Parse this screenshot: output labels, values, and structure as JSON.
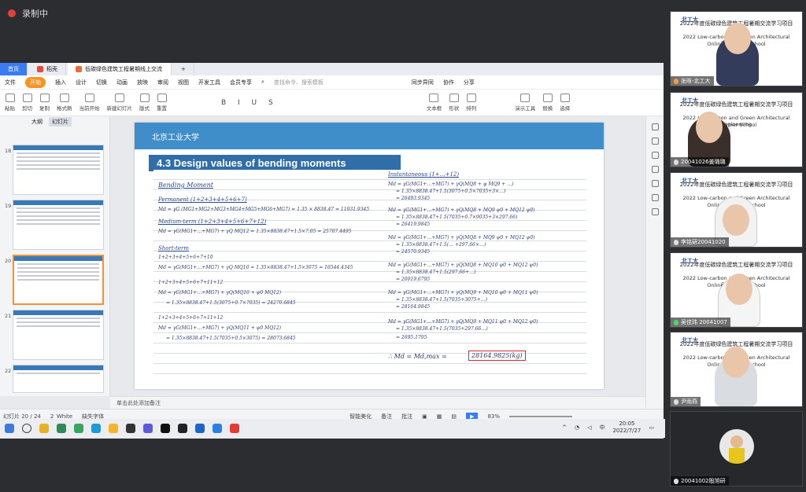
{
  "recording": {
    "label": "录制中"
  },
  "tabs": [
    {
      "label": "首页"
    },
    {
      "label": "稻壳"
    },
    {
      "label": "低碳绿色建筑工程暑期线上交流"
    }
  ],
  "menu": [
    "文件",
    "开始",
    "插入",
    "设计",
    "切换",
    "动画",
    "放映",
    "审阅",
    "视图",
    "开发工具",
    "会员专享"
  ],
  "search": {
    "placeholder": "查找命令、搜索模板"
  },
  "menu_right": [
    "同步异同",
    "协作",
    "分享"
  ],
  "ribbon": [
    "粘贴",
    "剪切",
    "复制",
    "格式刷",
    "当前开始",
    "新建幻灯片",
    "版式",
    "重置",
    "文本框",
    "形状",
    "排列",
    "演示工具",
    "替换",
    "选择"
  ],
  "sidepanel": {
    "tabs": [
      "大纲",
      "幻灯片"
    ],
    "thumbs": [
      "18",
      "19",
      "20",
      "21",
      "22"
    ]
  },
  "slide": {
    "univ": "北京工业大学",
    "title": "4.3 Design values of bending moments",
    "left": [
      "Bending Moment",
      "Permanent (1+2+3+4+5+6+7)",
      "Md = γG (MG1+MG2+MG3+MG4+MG5+MG6+MG7) = 1.35 × 8838.47 = 11931.9345",
      "Medium-term (1+2+3+4+5+6+7+12)",
      "Md = γG(MG1+…+MG7) + γQ MQ12 = 1.35×8838.47+1.5×7.05 = 25707.4495",
      "Short-term",
      "1+2+3+4+5+6+7+10",
      "Md = γG(MG1+…+MG7) + γQ MQ10 = 1.35×8838.47+1.5×3075 = 16544.4345",
      "1+2+3+4+5+6+7+11+12",
      "Md = γG(MG1+…+MG7) + γQ(MQ10 + ψ0 MQ12)",
      "= 1.35×8838.47+1.5(3075+0.7×7035) = 24270.6845",
      "1+2+3+4+5+6+7+11+12",
      "Md = γG(MG1+…+MG7) + γQ(MQ11 + ψ0 MQ12)",
      "= 1.35×8838.47+1.5(7035+0.5×3075) = 28073.6845"
    ],
    "right": [
      "Instantaneous (1+…+12)",
      "Md = γG(MG1+…+MG7) + γQ(MQ8 + ψ MQ9 + …)",
      "= 1.35×8838.47+1.5(3075+0.5×7035+3×…)",
      "= 26493.9345",
      "Md = γG(MG1+…+MG7) + γQ(MQ8 + MQ9 ψ0 + MQ12 ψ0)",
      "= 1.35×8838.47+1.5(7035+0.7×9035+3×297.66)",
      "= 26419.9845",
      "Md = γG(MG1+…+MG7) + γQ(MQ8 + MQ9 ψ0 + MQ12 ψ0)",
      "= 1.35×8838.47+1.5(… +297.66×…)",
      "= 24570.9345",
      "Md = γG(MG1+…+MG7) + γQ(MQ8 + MQ10 ψ0 + MQ12 ψ0)",
      "= 1.35×8838.47+1.5(297.66+…)",
      "= 20019.6795",
      "Md = γG(MG1+…+MG7) + γQ(MQ9 + MQ10 ψ0 + MQ11 ψ0)",
      "= 1.35×8838.47+1.5(7035+3075+…)",
      "= 28164.9845",
      "Md = γG(MG1+…+MG7) + γQ(MQ9 + MQ11 ψ0 + MQ12 ψ0)",
      "= 1.35×8838.47+1.5(7035+297.66…)",
      "= 2695.1795",
      "∴ Md = Md,max ="
    ],
    "answer": "28164.9825(kg)"
  },
  "notes": {
    "placeholder": "单击此处添加备注"
  },
  "status": {
    "slide": "幻灯片 20 / 24",
    "theme": "2_White",
    "font": "缺失字体",
    "beautify": "智能美化",
    "notes": "备注",
    "comments": "批注",
    "zoom": "83%"
  },
  "clock": {
    "time": "20:05",
    "date": "2022/7/27"
  },
  "ime": "中",
  "participants": [
    {
      "name": "张晗-北工大",
      "line1": "2022年度低碳绿色建筑工程暑期交流学习项目",
      "line2": "2022 Low-carbon and Green Architectural Engineering",
      "line3": "Online Summer School"
    },
    {
      "name": "20041026姜璐璐",
      "line1": "2022年度低碳绿色建筑工程暑期交流学习项目",
      "line2": "2022 Low-carbon and Green Architectural Engineering",
      "line3": "Summer School"
    },
    {
      "name": "李铭研20041020",
      "line1": "2022年度低碳绿色建筑工程暑期交流学习项目",
      "line2": "2022 Low-carbon and Green Architectural Engineering",
      "line3": "Online Summer School"
    },
    {
      "name": "吴佳玮 20041007",
      "line1": "2022年度低碳绿色建筑工程暑期交流学习项目",
      "line2": "2022 Low-carbon and Green Architectural Engineering",
      "line3": "Online Summer School"
    },
    {
      "name": "尹雨燕",
      "line1": "2022年度低碳绿色建筑工程暑期交流学习项目",
      "line2": "2022 Low-carbon and Green Architectural Engineering",
      "line3": "Online Summer School"
    },
    {
      "name": "20041002殷旭研"
    }
  ]
}
